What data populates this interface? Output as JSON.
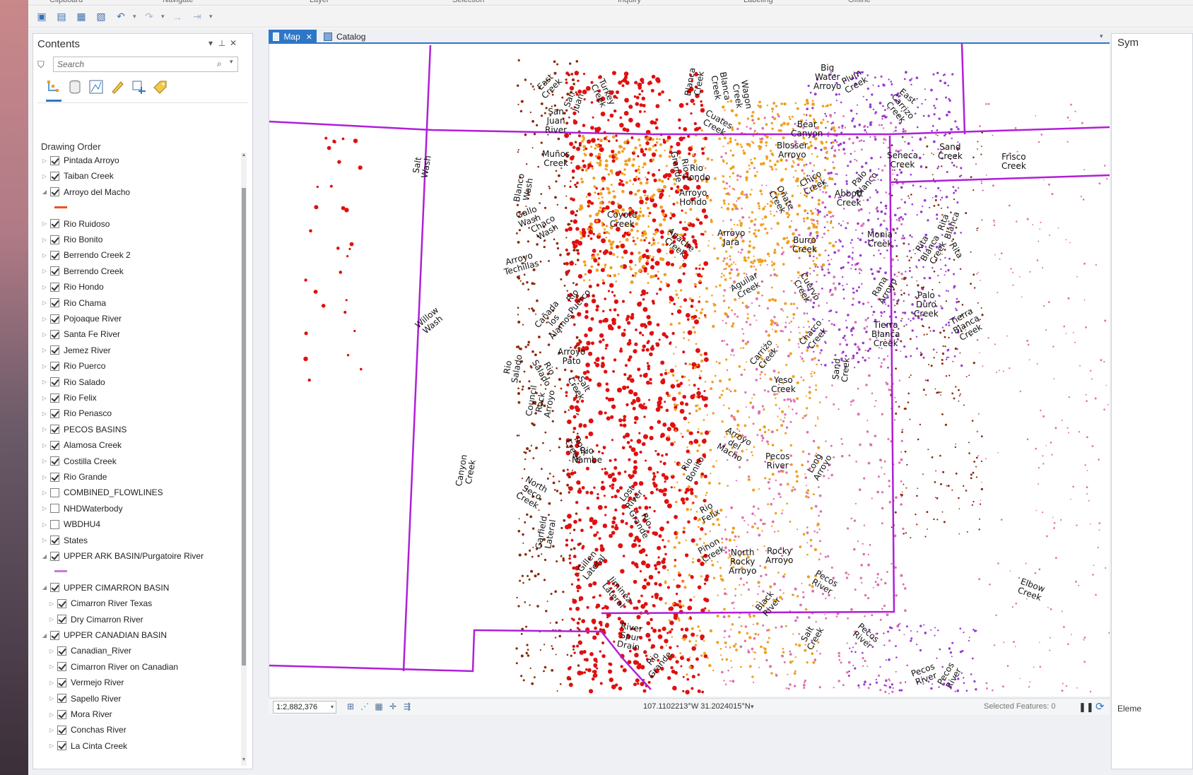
{
  "ribbon": {
    "groups": [
      "Clipboard",
      "Navigate",
      "Layer",
      "Selection",
      "Inquiry",
      "Labeling",
      "Offline"
    ]
  },
  "contents": {
    "title": "Contents",
    "search_placeholder": "Search",
    "section_label": "Drawing Order",
    "view_icons": [
      "list-by-drawing-order-icon",
      "list-by-data-source-icon",
      "list-by-selection-icon",
      "list-by-editing-icon",
      "list-by-snapping-icon",
      "list-by-labeling-icon"
    ],
    "layers": [
      {
        "label": "Pintada Arroyo",
        "checked": true,
        "expanded": false,
        "indent": 0
      },
      {
        "label": "Taiban Creek",
        "checked": true,
        "expanded": false,
        "indent": 0
      },
      {
        "label": "Arroyo del Macho",
        "checked": true,
        "expanded": true,
        "indent": 0,
        "swatch": "#e8551a"
      },
      {
        "label": "Rio Ruidoso",
        "checked": true,
        "expanded": false,
        "indent": 0
      },
      {
        "label": "Rio Bonito",
        "checked": true,
        "expanded": false,
        "indent": 0
      },
      {
        "label": "Berrendo Creek 2",
        "checked": true,
        "expanded": false,
        "indent": 0
      },
      {
        "label": "Berrendo Creek",
        "checked": true,
        "expanded": false,
        "indent": 0
      },
      {
        "label": "Rio Hondo",
        "checked": true,
        "expanded": false,
        "indent": 0
      },
      {
        "label": "Rio Chama",
        "checked": true,
        "expanded": false,
        "indent": 0
      },
      {
        "label": "Pojoaque River",
        "checked": true,
        "expanded": false,
        "indent": 0
      },
      {
        "label": "Santa Fe River",
        "checked": true,
        "expanded": false,
        "indent": 0
      },
      {
        "label": "Jemez River",
        "checked": true,
        "expanded": false,
        "indent": 0
      },
      {
        "label": "Rio Puerco",
        "checked": true,
        "expanded": false,
        "indent": 0
      },
      {
        "label": "Rio Salado",
        "checked": true,
        "expanded": false,
        "indent": 0
      },
      {
        "label": "Rio Felix",
        "checked": true,
        "expanded": false,
        "indent": 0
      },
      {
        "label": "Rio Penasco",
        "checked": true,
        "expanded": false,
        "indent": 0
      },
      {
        "label": "PECOS BASINS",
        "checked": true,
        "expanded": false,
        "indent": 0
      },
      {
        "label": "Alamosa Creek",
        "checked": true,
        "expanded": false,
        "indent": 0
      },
      {
        "label": "Costilla Creek",
        "checked": true,
        "expanded": false,
        "indent": 0
      },
      {
        "label": "Rio Grande",
        "checked": true,
        "expanded": false,
        "indent": 0
      },
      {
        "label": "COMBINED_FLOWLINES",
        "checked": false,
        "expanded": false,
        "indent": 0
      },
      {
        "label": "NHDWaterbody",
        "checked": false,
        "expanded": false,
        "indent": 0
      },
      {
        "label": "WBDHU4",
        "checked": false,
        "expanded": false,
        "indent": 0
      },
      {
        "label": "States",
        "checked": true,
        "expanded": false,
        "indent": 0
      },
      {
        "label": "UPPER ARK BASIN/Purgatoire River",
        "checked": true,
        "expanded": true,
        "indent": 0,
        "swatch": "#c77ad8"
      },
      {
        "label": "UPPER CIMARRON BASIN",
        "checked": true,
        "expanded": true,
        "indent": 0
      },
      {
        "label": "Cimarron River Texas",
        "checked": true,
        "expanded": false,
        "indent": 1
      },
      {
        "label": "Dry Cimarron River",
        "checked": true,
        "expanded": false,
        "indent": 1
      },
      {
        "label": "UPPER CANADIAN BASIN",
        "checked": true,
        "expanded": true,
        "indent": 0
      },
      {
        "label": "Canadian_River",
        "checked": true,
        "expanded": false,
        "indent": 1
      },
      {
        "label": "Cimarron River on Canadian",
        "checked": true,
        "expanded": false,
        "indent": 1
      },
      {
        "label": "Vermejo River",
        "checked": true,
        "expanded": false,
        "indent": 1
      },
      {
        "label": "Sapello River",
        "checked": true,
        "expanded": false,
        "indent": 1
      },
      {
        "label": "Mora River",
        "checked": true,
        "expanded": false,
        "indent": 1
      },
      {
        "label": "Conchas River",
        "checked": true,
        "expanded": false,
        "indent": 1
      },
      {
        "label": "La Cinta Creek",
        "checked": true,
        "expanded": false,
        "indent": 1
      }
    ]
  },
  "tabs": {
    "map_label": "Map",
    "catalog_label": "Catalog"
  },
  "map": {
    "colors": {
      "state_boundary": "#b01fd8",
      "dot_red": "#e01010",
      "dot_orange": "#f0a020",
      "dot_brown": "#8a2a08",
      "dot_pink": "#e070b0",
      "dot_purple": "#9a3ad0"
    },
    "labels": [
      {
        "text": "East\nCreek",
        "rot": -45
      },
      {
        "text": "San\nJuan\nRiver",
        "rot": 0
      },
      {
        "text": "San\nJuan",
        "rot": -70
      },
      {
        "text": "Turkey\nCreek",
        "rot": 65
      },
      {
        "text": "Blanca\nCreek",
        "rot": -80
      },
      {
        "text": "Blanca\nCreek",
        "rot": 80
      },
      {
        "text": "Wagon\nCreek",
        "rot": 80
      },
      {
        "text": "Big\nWater\nArroyo",
        "rot": 0
      },
      {
        "text": "Plum\nCreek",
        "rot": -30
      },
      {
        "text": "Carrizo\nCreek",
        "rot": 50
      },
      {
        "text": "East",
        "rot": 40
      },
      {
        "text": "Salt\nWash",
        "rot": -80
      },
      {
        "text": "Frisco\nCreek",
        "rot": 0
      },
      {
        "text": "Blanco\nWash",
        "rot": -80
      },
      {
        "text": "Gallo\nWash",
        "rot": -20
      },
      {
        "text": "Chaco\nWash",
        "rot": -30
      },
      {
        "text": "Arroyo\nTechillas",
        "rot": -15
      },
      {
        "text": "Muños\nCreek",
        "rot": 0
      },
      {
        "text": "Coyote\nCreek",
        "rot": 0
      },
      {
        "text": "Rio\nHondo",
        "rot": 0
      },
      {
        "text": "Arroyo\nHondo",
        "rot": 0
      },
      {
        "text": "Abbott\nCreek",
        "rot": 0
      },
      {
        "text": "Monia\nCreek",
        "rot": 0
      },
      {
        "text": "Rita\nBlanca\nCreek",
        "rot": -60
      },
      {
        "text": "Rita\nBlanca",
        "rot": -70
      },
      {
        "text": "Rita",
        "rot": 60
      },
      {
        "text": "Willow\nWash",
        "rot": -40
      },
      {
        "text": "Arroyo\nJara",
        "rot": 0
      },
      {
        "text": "Aguilar\nCreek",
        "rot": -30
      },
      {
        "text": "Rana\nArroyo",
        "rot": -60
      },
      {
        "text": "Palo\nDuro\nCreek",
        "rot": 0
      },
      {
        "text": "Tierra\nBlanca\nCreek",
        "rot": -30
      },
      {
        "text": "Tierra\nBlanca\nCreek",
        "rot": 0
      },
      {
        "text": "Rio\nSalado",
        "rot": -80
      },
      {
        "text": "Rio\nSalado",
        "rot": 60
      },
      {
        "text": "Sand\nCreek",
        "rot": -85
      },
      {
        "text": "Yeso\nCreek",
        "rot": 0
      },
      {
        "text": "Canyon\nCreek",
        "rot": -80
      },
      {
        "text": "Arroyo\ndel\nMacho",
        "rot": 30
      },
      {
        "text": "Pecos\nRiver",
        "rot": 0
      },
      {
        "text": "Long\nArroyo",
        "rot": -60
      },
      {
        "text": "North\nSeco\nCreek",
        "rot": 30
      },
      {
        "text": "Rio\nFelix",
        "rot": -30
      },
      {
        "text": "Pinon\nCreek",
        "rot": -30
      },
      {
        "text": "North\nRocky\nArroyo",
        "rot": 0
      },
      {
        "text": "Rocky\nArroyo",
        "rot": 0
      },
      {
        "text": "Pecos\nRiver",
        "rot": 30
      },
      {
        "text": "Elbow\nCreek",
        "rot": 20
      },
      {
        "text": "Black\nRiver",
        "rot": -50
      },
      {
        "text": "Salt\nCreek",
        "rot": -60
      },
      {
        "text": "Pecos\nRiver",
        "rot": 40
      },
      {
        "text": "Pecos\nRiver",
        "rot": -20
      },
      {
        "text": "Pecos\nRiver",
        "rot": -60
      },
      {
        "text": "River\nSpur\nDrain",
        "rot": 10
      },
      {
        "text": "Rio\nGrande",
        "rot": -50
      },
      {
        "text": "Jiminez\nLateral",
        "rot": 50
      },
      {
        "text": "Garfield\nLateral",
        "rot": -80
      },
      {
        "text": "Gillen\nLateral",
        "rot": -50
      },
      {
        "text": "Council\nRock\nArroyo",
        "rot": -80
      },
      {
        "text": "Bear\nCanyon",
        "rot": 0
      },
      {
        "text": "Blosser\nArroyo",
        "rot": 0
      },
      {
        "text": "Burro\nCreek",
        "rot": 0
      },
      {
        "text": "Seneca\nCreek",
        "rot": 0
      },
      {
        "text": "Sand\nCreek",
        "rot": 0
      },
      {
        "text": "Cuates\nCreek",
        "rot": 30
      },
      {
        "text": "Rio\nGrande",
        "rot": 80
      },
      {
        "text": "Rio\nBonito",
        "rot": -60
      },
      {
        "text": "Carrizo\nCreek",
        "rot": -50
      },
      {
        "text": "Cuervo\nCreek",
        "rot": 60
      },
      {
        "text": "Charco\nCreek",
        "rot": -50
      },
      {
        "text": "Rio\nPuerco",
        "rot": -50
      },
      {
        "text": "Cañada\nlos\nAlamos",
        "rot": -50
      },
      {
        "text": "Arroyo\nPato",
        "rot": 0
      },
      {
        "text": "Salt\nCreek",
        "rot": 60
      },
      {
        "text": "Lost\nRiver",
        "rot": -50
      },
      {
        "text": "Rio\nGrande",
        "rot": 60
      },
      {
        "text": "Rock\nCreek",
        "rot": 60
      },
      {
        "text": "Rio\nNambe",
        "rot": 0
      },
      {
        "text": "Apache\nCreek",
        "rot": 40
      },
      {
        "text": "Palo\nBlanco",
        "rot": -50
      },
      {
        "text": "Chico\nCreek",
        "rot": -30
      },
      {
        "text": "Oñate\nCreek",
        "rot": 60
      }
    ]
  },
  "status": {
    "scale": "1:2,882,376",
    "coords": "107.1102213°W 31.2024015°N",
    "selected_features": "Selected Features: 0"
  },
  "right_pane": {
    "title": "Sym",
    "footer": "Eleme"
  }
}
